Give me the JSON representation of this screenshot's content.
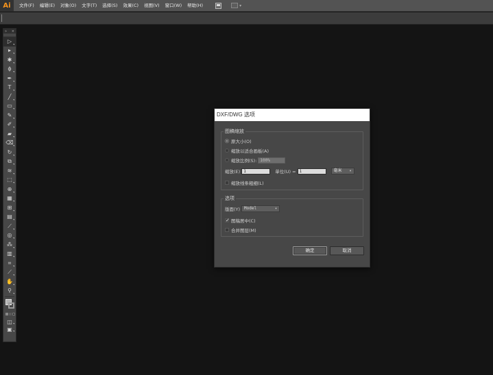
{
  "app": {
    "logo": "Ai"
  },
  "menu": [
    "文件(F)",
    "编辑(E)",
    "对象(O)",
    "文字(T)",
    "选择(S)",
    "效果(C)",
    "视图(V)",
    "窗口(W)",
    "帮助(H)"
  ],
  "toolbar": {
    "tools": [
      {
        "name": "selection-tool-icon",
        "glyph": "▷"
      },
      {
        "name": "direct-selection-tool-icon",
        "glyph": "▸"
      },
      {
        "name": "magic-wand-tool-icon",
        "glyph": "✱"
      },
      {
        "name": "lasso-tool-icon",
        "glyph": "ϕ"
      },
      {
        "name": "pen-tool-icon",
        "glyph": "✒"
      },
      {
        "name": "type-tool-icon",
        "glyph": "T"
      },
      {
        "name": "line-tool-icon",
        "glyph": "╱"
      },
      {
        "name": "rectangle-tool-icon",
        "glyph": "▭"
      },
      {
        "name": "paintbrush-tool-icon",
        "glyph": "✎"
      },
      {
        "name": "pencil-tool-icon",
        "glyph": "✐"
      },
      {
        "name": "blob-brush-tool-icon",
        "glyph": "▰"
      },
      {
        "name": "eraser-tool-icon",
        "glyph": "⌫"
      },
      {
        "name": "rotate-tool-icon",
        "glyph": "↻"
      },
      {
        "name": "scale-tool-icon",
        "glyph": "⧉"
      },
      {
        "name": "warp-tool-icon",
        "glyph": "≋"
      },
      {
        "name": "free-transform-tool-icon",
        "glyph": "⬚"
      },
      {
        "name": "shape-builder-tool-icon",
        "glyph": "⊕"
      },
      {
        "name": "perspective-grid-tool-icon",
        "glyph": "▦"
      },
      {
        "name": "mesh-tool-icon",
        "glyph": "⊞"
      },
      {
        "name": "gradient-tool-icon",
        "glyph": "▤"
      },
      {
        "name": "eyedropper-tool-icon",
        "glyph": "⟋"
      },
      {
        "name": "blend-tool-icon",
        "glyph": "◎"
      },
      {
        "name": "symbol-sprayer-tool-icon",
        "glyph": "⁂"
      },
      {
        "name": "column-graph-tool-icon",
        "glyph": "▥"
      },
      {
        "name": "artboard-tool-icon",
        "glyph": "⌗"
      },
      {
        "name": "slice-tool-icon",
        "glyph": "⟋"
      },
      {
        "name": "hand-tool-icon",
        "glyph": "✋"
      },
      {
        "name": "zoom-tool-icon",
        "glyph": "⚲"
      }
    ]
  },
  "dialog": {
    "title": "DXF/DWG 选项",
    "scale_group": {
      "title": "图稿缩放",
      "original_size": "原大小(O)",
      "fit_artboard": "缩放以适合画板(A)",
      "scale_ratio_label": "缩放比例(S):",
      "scale_ratio_value": "100%",
      "scale_label": "缩放(E)",
      "scale_value": "1",
      "units_label": "单位(U) =",
      "units_value": "1",
      "unit_select": "毫米",
      "scale_strokes": "缩放线条粗细(L)"
    },
    "options_group": {
      "title": "选项",
      "layout_label": "版面(Y)",
      "layout_value": "Model",
      "center_artwork": "图稿居中(C)",
      "merge_layers": "合并图层(M)"
    },
    "ok_label": "确定",
    "cancel_label": "取消"
  }
}
